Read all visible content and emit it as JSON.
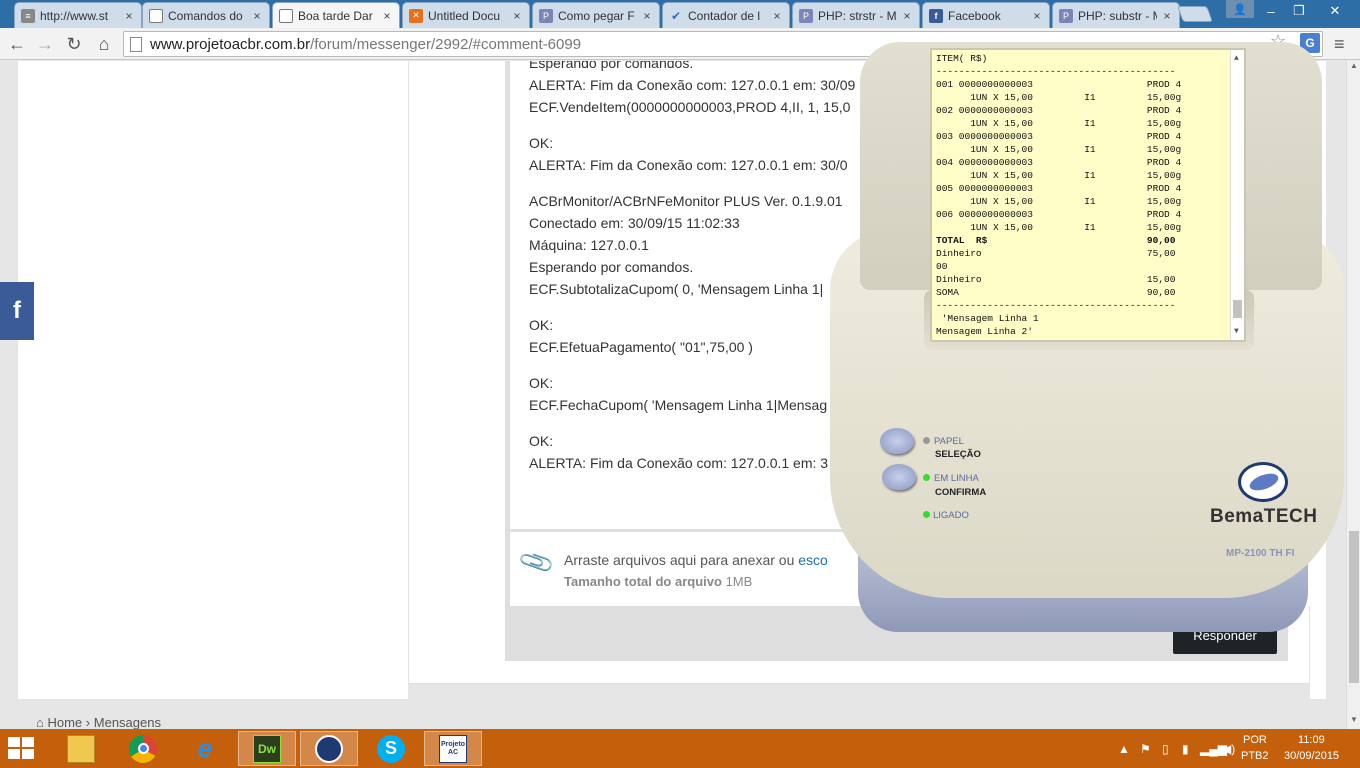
{
  "browser": {
    "tabs": [
      {
        "title": "http://www.st",
        "icon": "stack-icon"
      },
      {
        "title": "Comandos do",
        "icon": "page-icon"
      },
      {
        "title": "Boa tarde Dar",
        "icon": "page-icon"
      },
      {
        "title": "Untitled Docu",
        "icon": "doc-icon"
      },
      {
        "title": "Como pegar F",
        "icon": "php-icon"
      },
      {
        "title": "Contador de l",
        "icon": "check-icon"
      },
      {
        "title": "PHP: strstr - M",
        "icon": "php-icon"
      },
      {
        "title": "Facebook",
        "icon": "facebook-icon"
      },
      {
        "title": "PHP: substr - M",
        "icon": "php-icon"
      }
    ],
    "tab_close": "×",
    "url_host": "www.projetoacbr.com.br",
    "url_path": "/forum/messenger/2992/#comment-6099"
  },
  "message": {
    "lines": [
      "Esperando por comandos.",
      "ALERTA: Fim da Conexão com: 127.0.0.1 em: 30/09",
      "ECF.VendeItem(0000000000003,PROD 4,II, 1, 15,0",
      "",
      "OK:",
      "ALERTA: Fim da Conexão com: 127.0.0.1 em: 30/0",
      "",
      "ACBrMonitor/ACBrNFeMonitor PLUS Ver. 0.1.9.01",
      "Conectado em: 30/09/15 11:02:33",
      "Máquina: 127.0.0.1",
      "Esperando por comandos.",
      "ECF.SubtotalizaCupom( 0, 'Mensagem Linha 1|",
      "",
      "OK:",
      "ECF.EfetuaPagamento( \"01\",75,00 )",
      "",
      "OK:",
      "ECF.FechaCupom( 'Mensagem Linha 1|Mensag",
      "",
      "OK:",
      "ALERTA: Fim da Conexão com: 127.0.0.1 em: 3"
    ]
  },
  "attach": {
    "text": "Arraste arquivos aqui para anexar ou ",
    "link": "esco",
    "size_label": "Tamanho total do arquivo",
    "size_value": "1MB"
  },
  "reply_label": "Responder",
  "breadcrumb": {
    "home": "Home",
    "sep": "›",
    "current": "Mensagens"
  },
  "facebook_side": "f",
  "receipt": {
    "lines": [
      {
        "t": "ITEM( R$)",
        "b": false
      },
      {
        "t": "------------------------------------------",
        "b": false
      },
      {
        "t": "001 0000000000003                    PROD 4",
        "b": false
      },
      {
        "t": "      1UN X 15,00         I1         15,00g",
        "b": false
      },
      {
        "t": "002 0000000000003                    PROD 4",
        "b": false
      },
      {
        "t": "      1UN X 15,00         I1         15,00g",
        "b": false
      },
      {
        "t": "003 0000000000003                    PROD 4",
        "b": false
      },
      {
        "t": "      1UN X 15,00         I1         15,00g",
        "b": false
      },
      {
        "t": "004 0000000000003                    PROD 4",
        "b": false
      },
      {
        "t": "      1UN X 15,00         I1         15,00g",
        "b": false
      },
      {
        "t": "005 0000000000003                    PROD 4",
        "b": false
      },
      {
        "t": "      1UN X 15,00         I1         15,00g",
        "b": false
      },
      {
        "t": "006 0000000000003                    PROD 4",
        "b": false
      },
      {
        "t": "      1UN X 15,00         I1         15,00g",
        "b": false
      },
      {
        "t": "TOTAL  R$                            90,00",
        "b": true
      },
      {
        "t": "Dinheiro                             75,00",
        "b": false
      },
      {
        "t": "00",
        "b": false
      },
      {
        "t": "Dinheiro                             15,00",
        "b": false
      },
      {
        "t": "SOMA                                 90,00",
        "b": false
      },
      {
        "t": "------------------------------------------",
        "b": false
      },
      {
        "t": " 'Mensagem Linha 1",
        "b": false
      },
      {
        "t": "Mensagem Linha 2'",
        "b": false
      }
    ]
  },
  "printer": {
    "papel": "PAPEL",
    "selecao": "SELEÇÃO",
    "em_linha": "EM LINHA",
    "confirma": "CONFIRMA",
    "ligado": "LIGADO",
    "brand": "BemaTECH",
    "model": "MP-2100 TH FI",
    "led_color": "#33dd33"
  },
  "taskbar": {
    "apps": [
      {
        "name": "file-explorer-icon",
        "label": ""
      },
      {
        "name": "chrome-icon",
        "label": ""
      },
      {
        "name": "internet-explorer-icon",
        "label": "e"
      },
      {
        "name": "dreamweaver-icon",
        "label": "Dw"
      },
      {
        "name": "acbr-monitor-icon",
        "label": ""
      },
      {
        "name": "skype-icon",
        "label": "S"
      },
      {
        "name": "projeto-acbr-icon",
        "label": "Projeto AC"
      }
    ],
    "lang1": "POR",
    "lang2": "PTB2",
    "time": "11:09",
    "date": "30/09/2015"
  }
}
